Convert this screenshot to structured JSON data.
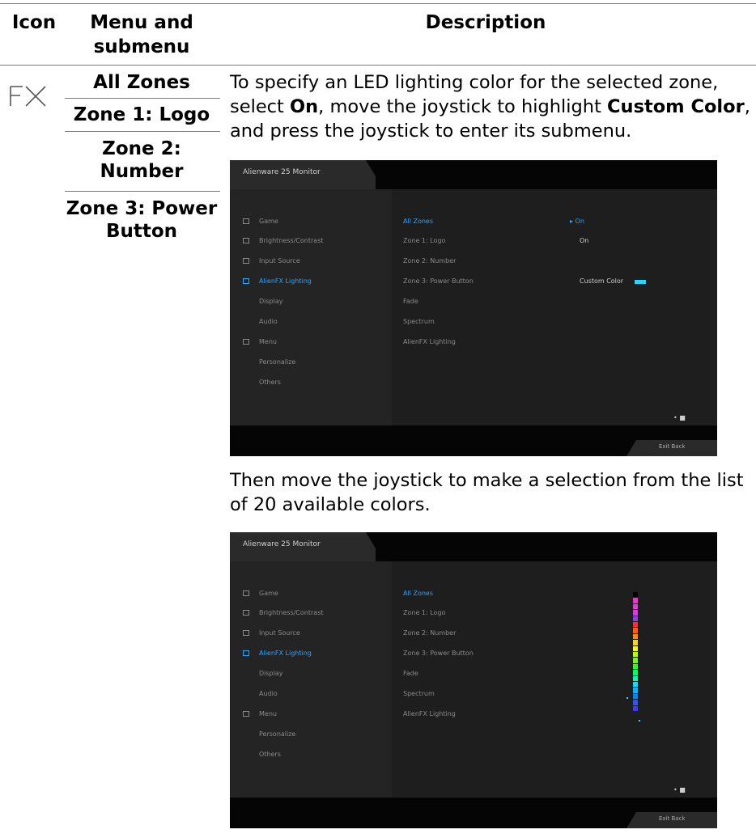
{
  "table": {
    "headers": {
      "icon": "Icon",
      "menu_line1": "Menu and",
      "menu_line2": "submenu",
      "description": "Description"
    },
    "icon_name": "fx-icon",
    "icon_glyph": "FX",
    "menu_items": [
      "All Zones",
      "Zone 1: Logo",
      "Zone 2:",
      "Number",
      "Zone 3: Power",
      "Button"
    ],
    "desc1": {
      "l1": "To specify an LED lighting color for the selected zone,",
      "l2a": "select ",
      "l2b": "On",
      "l2c": ", move the joystick to highlight ",
      "l2d": "Custom Color",
      "l2e": ",",
      "l3": "and press the joystick to enter its submenu."
    },
    "desc2": {
      "l1": "Then move the joystick to make a selection from the list",
      "l2": "of 20 available colors."
    }
  },
  "osd": {
    "title": "Alienware 25 Monitor",
    "footer": "Exit  Back",
    "corner": "• ■",
    "menu": [
      "Game",
      "Brightness/Contrast",
      "Input Source",
      "AlienFX Lighting",
      "Display",
      "Audio",
      "Menu",
      "Personalize",
      "Others"
    ],
    "selected_menu": "AlienFX Lighting",
    "submenu": [
      "All Zones",
      "Zone 1: Logo",
      "Zone 2: Number",
      "Zone 3: Power Button",
      "Fade",
      "Spectrum",
      "AlienFX Lighting"
    ],
    "values": {
      "v1": "▸ On",
      "v2": "On",
      "custom": "Custom Color"
    },
    "colors": [
      "#000000",
      "#ff2bd6",
      "#e63bd8",
      "#cf3fe0",
      "#8e3fe8",
      "#ff2f2f",
      "#ff5a1e",
      "#ff8a00",
      "#ffd400",
      "#f2ff00",
      "#b9ff00",
      "#6cff00",
      "#2dff2d",
      "#00ff6a",
      "#00ffb4",
      "#00e4ff",
      "#00b4ff",
      "#0084ff",
      "#2b55ff",
      "#3b3bff"
    ],
    "accent": "#2aa4ff"
  }
}
